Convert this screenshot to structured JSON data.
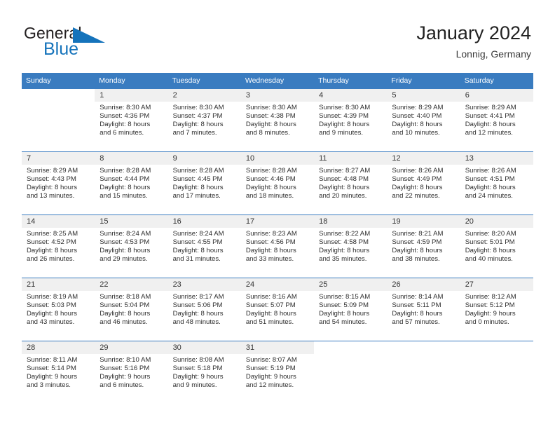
{
  "brand": {
    "word_general": "General",
    "word_blue": "Blue",
    "triangle_color": "#1573bb",
    "text_color": "#231f20"
  },
  "header": {
    "title": "January 2024",
    "subtitle": "Lonnig, Germany"
  },
  "theme": {
    "header_blue": "#3a7cc0",
    "daynum_band": "#f0f0f0",
    "text": "#2e2e2e"
  },
  "weekday_headers": [
    "Sunday",
    "Monday",
    "Tuesday",
    "Wednesday",
    "Thursday",
    "Friday",
    "Saturday"
  ],
  "weeks": [
    [
      {
        "day": "",
        "sunrise": "",
        "sunset": "",
        "daylight_a": "",
        "daylight_b": ""
      },
      {
        "day": "1",
        "sunrise": "Sunrise: 8:30 AM",
        "sunset": "Sunset: 4:36 PM",
        "daylight_a": "Daylight: 8 hours",
        "daylight_b": "and 6 minutes."
      },
      {
        "day": "2",
        "sunrise": "Sunrise: 8:30 AM",
        "sunset": "Sunset: 4:37 PM",
        "daylight_a": "Daylight: 8 hours",
        "daylight_b": "and 7 minutes."
      },
      {
        "day": "3",
        "sunrise": "Sunrise: 8:30 AM",
        "sunset": "Sunset: 4:38 PM",
        "daylight_a": "Daylight: 8 hours",
        "daylight_b": "and 8 minutes."
      },
      {
        "day": "4",
        "sunrise": "Sunrise: 8:30 AM",
        "sunset": "Sunset: 4:39 PM",
        "daylight_a": "Daylight: 8 hours",
        "daylight_b": "and 9 minutes."
      },
      {
        "day": "5",
        "sunrise": "Sunrise: 8:29 AM",
        "sunset": "Sunset: 4:40 PM",
        "daylight_a": "Daylight: 8 hours",
        "daylight_b": "and 10 minutes."
      },
      {
        "day": "6",
        "sunrise": "Sunrise: 8:29 AM",
        "sunset": "Sunset: 4:41 PM",
        "daylight_a": "Daylight: 8 hours",
        "daylight_b": "and 12 minutes."
      }
    ],
    [
      {
        "day": "7",
        "sunrise": "Sunrise: 8:29 AM",
        "sunset": "Sunset: 4:43 PM",
        "daylight_a": "Daylight: 8 hours",
        "daylight_b": "and 13 minutes."
      },
      {
        "day": "8",
        "sunrise": "Sunrise: 8:28 AM",
        "sunset": "Sunset: 4:44 PM",
        "daylight_a": "Daylight: 8 hours",
        "daylight_b": "and 15 minutes."
      },
      {
        "day": "9",
        "sunrise": "Sunrise: 8:28 AM",
        "sunset": "Sunset: 4:45 PM",
        "daylight_a": "Daylight: 8 hours",
        "daylight_b": "and 17 minutes."
      },
      {
        "day": "10",
        "sunrise": "Sunrise: 8:28 AM",
        "sunset": "Sunset: 4:46 PM",
        "daylight_a": "Daylight: 8 hours",
        "daylight_b": "and 18 minutes."
      },
      {
        "day": "11",
        "sunrise": "Sunrise: 8:27 AM",
        "sunset": "Sunset: 4:48 PM",
        "daylight_a": "Daylight: 8 hours",
        "daylight_b": "and 20 minutes."
      },
      {
        "day": "12",
        "sunrise": "Sunrise: 8:26 AM",
        "sunset": "Sunset: 4:49 PM",
        "daylight_a": "Daylight: 8 hours",
        "daylight_b": "and 22 minutes."
      },
      {
        "day": "13",
        "sunrise": "Sunrise: 8:26 AM",
        "sunset": "Sunset: 4:51 PM",
        "daylight_a": "Daylight: 8 hours",
        "daylight_b": "and 24 minutes."
      }
    ],
    [
      {
        "day": "14",
        "sunrise": "Sunrise: 8:25 AM",
        "sunset": "Sunset: 4:52 PM",
        "daylight_a": "Daylight: 8 hours",
        "daylight_b": "and 26 minutes."
      },
      {
        "day": "15",
        "sunrise": "Sunrise: 8:24 AM",
        "sunset": "Sunset: 4:53 PM",
        "daylight_a": "Daylight: 8 hours",
        "daylight_b": "and 29 minutes."
      },
      {
        "day": "16",
        "sunrise": "Sunrise: 8:24 AM",
        "sunset": "Sunset: 4:55 PM",
        "daylight_a": "Daylight: 8 hours",
        "daylight_b": "and 31 minutes."
      },
      {
        "day": "17",
        "sunrise": "Sunrise: 8:23 AM",
        "sunset": "Sunset: 4:56 PM",
        "daylight_a": "Daylight: 8 hours",
        "daylight_b": "and 33 minutes."
      },
      {
        "day": "18",
        "sunrise": "Sunrise: 8:22 AM",
        "sunset": "Sunset: 4:58 PM",
        "daylight_a": "Daylight: 8 hours",
        "daylight_b": "and 35 minutes."
      },
      {
        "day": "19",
        "sunrise": "Sunrise: 8:21 AM",
        "sunset": "Sunset: 4:59 PM",
        "daylight_a": "Daylight: 8 hours",
        "daylight_b": "and 38 minutes."
      },
      {
        "day": "20",
        "sunrise": "Sunrise: 8:20 AM",
        "sunset": "Sunset: 5:01 PM",
        "daylight_a": "Daylight: 8 hours",
        "daylight_b": "and 40 minutes."
      }
    ],
    [
      {
        "day": "21",
        "sunrise": "Sunrise: 8:19 AM",
        "sunset": "Sunset: 5:03 PM",
        "daylight_a": "Daylight: 8 hours",
        "daylight_b": "and 43 minutes."
      },
      {
        "day": "22",
        "sunrise": "Sunrise: 8:18 AM",
        "sunset": "Sunset: 5:04 PM",
        "daylight_a": "Daylight: 8 hours",
        "daylight_b": "and 46 minutes."
      },
      {
        "day": "23",
        "sunrise": "Sunrise: 8:17 AM",
        "sunset": "Sunset: 5:06 PM",
        "daylight_a": "Daylight: 8 hours",
        "daylight_b": "and 48 minutes."
      },
      {
        "day": "24",
        "sunrise": "Sunrise: 8:16 AM",
        "sunset": "Sunset: 5:07 PM",
        "daylight_a": "Daylight: 8 hours",
        "daylight_b": "and 51 minutes."
      },
      {
        "day": "25",
        "sunrise": "Sunrise: 8:15 AM",
        "sunset": "Sunset: 5:09 PM",
        "daylight_a": "Daylight: 8 hours",
        "daylight_b": "and 54 minutes."
      },
      {
        "day": "26",
        "sunrise": "Sunrise: 8:14 AM",
        "sunset": "Sunset: 5:11 PM",
        "daylight_a": "Daylight: 8 hours",
        "daylight_b": "and 57 minutes."
      },
      {
        "day": "27",
        "sunrise": "Sunrise: 8:12 AM",
        "sunset": "Sunset: 5:12 PM",
        "daylight_a": "Daylight: 9 hours",
        "daylight_b": "and 0 minutes."
      }
    ],
    [
      {
        "day": "28",
        "sunrise": "Sunrise: 8:11 AM",
        "sunset": "Sunset: 5:14 PM",
        "daylight_a": "Daylight: 9 hours",
        "daylight_b": "and 3 minutes."
      },
      {
        "day": "29",
        "sunrise": "Sunrise: 8:10 AM",
        "sunset": "Sunset: 5:16 PM",
        "daylight_a": "Daylight: 9 hours",
        "daylight_b": "and 6 minutes."
      },
      {
        "day": "30",
        "sunrise": "Sunrise: 8:08 AM",
        "sunset": "Sunset: 5:18 PM",
        "daylight_a": "Daylight: 9 hours",
        "daylight_b": "and 9 minutes."
      },
      {
        "day": "31",
        "sunrise": "Sunrise: 8:07 AM",
        "sunset": "Sunset: 5:19 PM",
        "daylight_a": "Daylight: 9 hours",
        "daylight_b": "and 12 minutes."
      },
      {
        "day": "",
        "sunrise": "",
        "sunset": "",
        "daylight_a": "",
        "daylight_b": ""
      },
      {
        "day": "",
        "sunrise": "",
        "sunset": "",
        "daylight_a": "",
        "daylight_b": ""
      },
      {
        "day": "",
        "sunrise": "",
        "sunset": "",
        "daylight_a": "",
        "daylight_b": ""
      }
    ]
  ]
}
